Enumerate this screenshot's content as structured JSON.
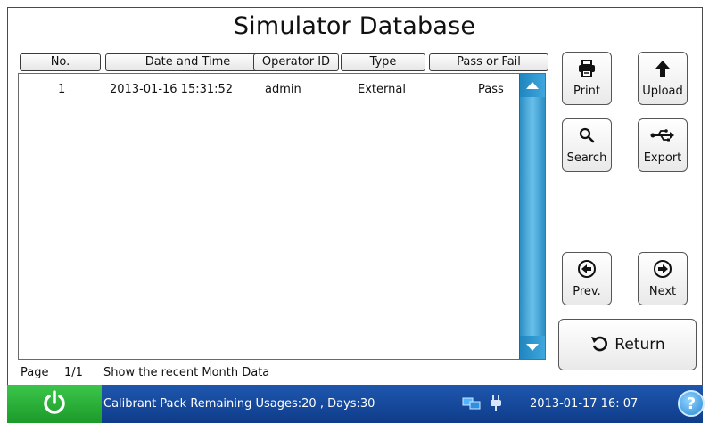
{
  "title": "Simulator Database",
  "columns": [
    "No.",
    "Date and Time",
    "Operator ID",
    "Type",
    "Pass or Fail"
  ],
  "rows": [
    {
      "no": "1",
      "datetime": "2013-01-16 15:31:52",
      "operator": "admin",
      "type": "External",
      "result": "Pass"
    }
  ],
  "buttons": {
    "print": "Print",
    "upload": "Upload",
    "search": "Search",
    "export": "Export",
    "prev": "Prev.",
    "next": "Next",
    "return": "Return"
  },
  "footer": {
    "page_label": "Page",
    "page_value": "1/1",
    "filter_text": "Show the recent Month Data"
  },
  "status": {
    "message": "Calibrant Pack Remaining Usages:20 , Days:30",
    "datetime": "2013-01-17  16: 07",
    "help": "?"
  },
  "icons": [
    "printer-icon",
    "up-arrow-icon",
    "search-icon",
    "usb-icon",
    "left-arrow-circle-icon",
    "right-arrow-circle-icon",
    "return-arrow-icon",
    "power-icon",
    "network-icon",
    "plug-icon",
    "help-icon"
  ],
  "colors": {
    "scrollbar": "#3fa7dd",
    "statusbar": "#1e57ae",
    "power": "#2bb23a"
  }
}
